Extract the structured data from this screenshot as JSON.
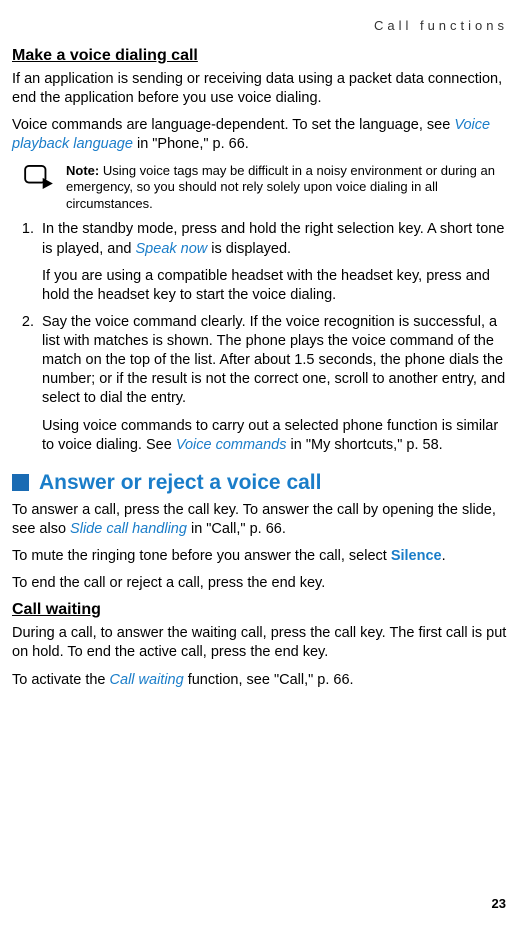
{
  "runningHeader": "Call functions",
  "pageNumber": "23",
  "sec1": {
    "title": "Make a voice dialing call",
    "p1": "If an application is sending or receiving data using a packet data connection, end the application before you use voice dialing.",
    "p2a": "Voice commands are language-dependent. To set the language, see ",
    "p2link": "Voice playback language",
    "p2b": " in \"Phone,\" p. 66."
  },
  "note": {
    "label": "Note:",
    "text": " Using voice tags may be difficult in a noisy environment or during an emergency, so you should not rely solely upon voice dialing in all circumstances."
  },
  "list": {
    "item1a": "In the standby mode, press and hold the right selection key. A short tone is played, and ",
    "item1link": "Speak now",
    "item1b": " is displayed.",
    "item1sub": "If you are using a compatible headset with the headset key, press and hold the headset key to start the voice dialing.",
    "item2": "Say the voice command clearly. If the voice recognition is successful, a list with matches is shown. The phone plays the voice command of the match on the top of the list. After about 1.5 seconds, the phone dials the number; or if the result is not the correct one, scroll to another entry, and select to dial the entry.",
    "item2suba": "Using voice commands to carry out a selected phone function is similar to voice dialing. See ",
    "item2sublink": "Voice commands",
    "item2subb": " in \"My shortcuts,\" p. 58."
  },
  "sec2": {
    "title": "Answer or reject a voice call",
    "p1a": "To answer a call, press the call key. To answer the call by opening the slide, see also ",
    "p1link": "Slide call handling",
    "p1b": " in \"Call,\" p. 66.",
    "p2a": "To mute the ringing tone before you answer the call, select ",
    "p2link": "Silence",
    "p2b": ".",
    "p3": "To end the call or reject a call, press the end key."
  },
  "sec3": {
    "title": "Call waiting",
    "p1": "During a call, to answer the waiting call, press the call key. The first call is put on hold. To end the active call, press the end key.",
    "p2a": "To activate the ",
    "p2link": "Call waiting",
    "p2b": " function, see \"Call,\" p. 66."
  }
}
